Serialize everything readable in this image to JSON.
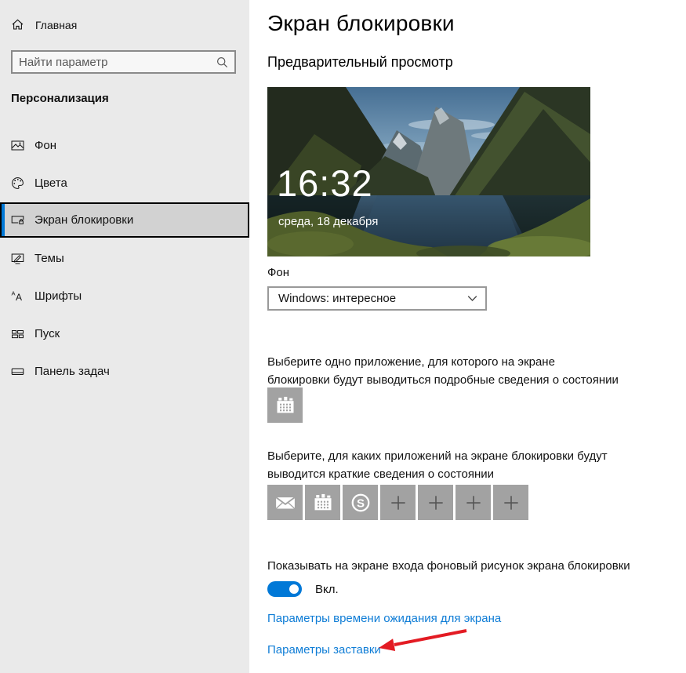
{
  "sidebar": {
    "home_label": "Главная",
    "search_placeholder": "Найти параметр",
    "section_title": "Персонализация",
    "items": [
      {
        "label": "Фон",
        "icon": "background-icon",
        "selected": false
      },
      {
        "label": "Цвета",
        "icon": "colors-icon",
        "selected": false
      },
      {
        "label": "Экран блокировки",
        "icon": "lock-screen-icon",
        "selected": true
      },
      {
        "label": "Темы",
        "icon": "themes-icon",
        "selected": false
      },
      {
        "label": "Шрифты",
        "icon": "fonts-icon",
        "selected": false
      },
      {
        "label": "Пуск",
        "icon": "start-icon",
        "selected": false
      },
      {
        "label": "Панель задач",
        "icon": "taskbar-icon",
        "selected": false
      }
    ]
  },
  "main": {
    "title": "Экран блокировки",
    "preview_heading": "Предварительный просмотр",
    "preview": {
      "time": "16:32",
      "date": "среда, 18 декабря"
    },
    "background": {
      "label": "Фон",
      "selected_value": "Windows: интересное"
    },
    "detailed_status_text": "Выберите одно приложение, для которого на экране блокировки будут выводиться подробные сведения о состоянии",
    "detailed_status_app_icon": "calendar-icon",
    "quick_status_text": "Выберите, для каких приложений на экране блокировки будут выводится краткие сведения о состоянии",
    "quick_status_app_icons": [
      "mail-icon",
      "calendar-icon",
      "skype-icon",
      "plus-icon",
      "plus-icon",
      "plus-icon",
      "plus-icon"
    ],
    "sign_in_background_text": "Показывать на экране входа фоновый рисунок экрана блокировки",
    "toggle_state_label": "Вкл.",
    "links": [
      {
        "label": "Параметры времени ожидания для экрана"
      },
      {
        "label": "Параметры заставки"
      }
    ]
  },
  "colors": {
    "accent": "#0078d7",
    "link": "#0f7dd6",
    "annotation_arrow": "#e31b23",
    "sidebar_bg": "#eaeaea",
    "selected_item_bg": "#d2d2d2",
    "app_tile_gray": "#a2a2a2"
  }
}
